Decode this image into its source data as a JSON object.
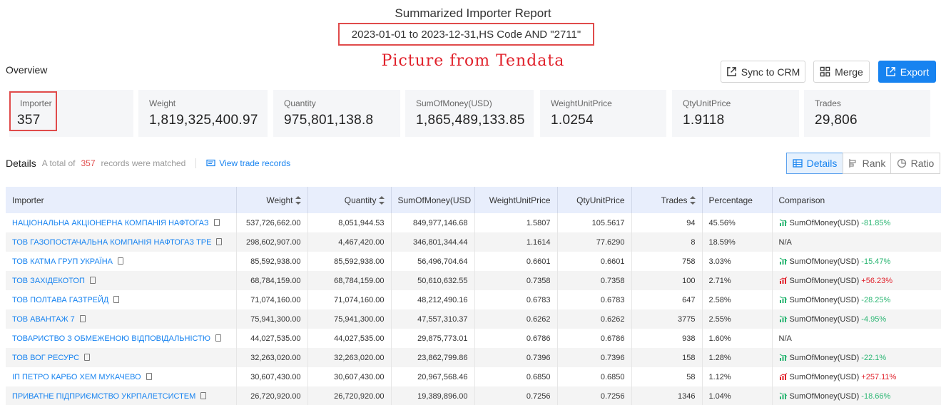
{
  "report": {
    "title": "Summarized Importer Report",
    "subtitle": "2023-01-01 to 2023-12-31,HS Code AND \"2711\"",
    "watermark": "Picture from Tendata"
  },
  "overview": {
    "label": "Overview",
    "buttons": {
      "sync": "Sync to CRM",
      "merge": "Merge",
      "export": "Export"
    },
    "stats": [
      {
        "label": "Importer",
        "value": "357"
      },
      {
        "label": "Weight",
        "value": "1,819,325,400.97"
      },
      {
        "label": "Quantity",
        "value": "975,801,138.8"
      },
      {
        "label": "SumOfMoney(USD)",
        "value": "1,865,489,133.85"
      },
      {
        "label": "WeightUnitPrice",
        "value": "1.0254"
      },
      {
        "label": "QtyUnitPrice",
        "value": "1.9118"
      },
      {
        "label": "Trades",
        "value": "29,806"
      }
    ]
  },
  "details": {
    "label": "Details",
    "total_prefix": "A total of",
    "total_count": "357",
    "total_suffix": "records were matched",
    "view_link": "View trade records",
    "tabs": [
      "Details",
      "Rank",
      "Ratio"
    ],
    "columns": [
      "Importer",
      "Weight",
      "Quantity",
      "SumOfMoney(USD",
      "WeightUnitPrice",
      "QtyUnitPrice",
      "Trades",
      "Percentage",
      "Comparison"
    ],
    "rows": [
      {
        "importer": "НАЦІОНАЛЬНА АКЦІОНЕРНА КОМПАНІЯ НАФТОГАЗ",
        "weight": "537,726,662.00",
        "quantity": "8,051,944.53",
        "money": "849,977,146.68",
        "wup": "1.5807",
        "qup": "105.5617",
        "trades": "94",
        "pct": "45.56%",
        "cmp_label": "SumOfMoney(USD)",
        "cmp_val": "-81.85%",
        "dir": "down"
      },
      {
        "importer": "ТОВ ГАЗОПОСТАЧАЛЬНА КОМПАНІЯ НАФТОГАЗ ТРЕ",
        "weight": "298,602,907.00",
        "quantity": "4,467,420.00",
        "money": "346,801,344.44",
        "wup": "1.1614",
        "qup": "77.6290",
        "trades": "8",
        "pct": "18.59%",
        "cmp_label": "N/A",
        "cmp_val": "",
        "dir": "none"
      },
      {
        "importer": "ТОВ КАТМА ГРУП УКРАЇНА",
        "weight": "85,592,938.00",
        "quantity": "85,592,938.00",
        "money": "56,496,704.64",
        "wup": "0.6601",
        "qup": "0.6601",
        "trades": "758",
        "pct": "3.03%",
        "cmp_label": "SumOfMoney(USD)",
        "cmp_val": "-15.47%",
        "dir": "down"
      },
      {
        "importer": "ТОВ ЗАХІДЕКОТОП",
        "weight": "68,784,159.00",
        "quantity": "68,784,159.00",
        "money": "50,610,632.55",
        "wup": "0.7358",
        "qup": "0.7358",
        "trades": "100",
        "pct": "2.71%",
        "cmp_label": "SumOfMoney(USD)",
        "cmp_val": "+56.23%",
        "dir": "up"
      },
      {
        "importer": "ТОВ ПОЛТАВА ГАЗТРЕЙД",
        "weight": "71,074,160.00",
        "quantity": "71,074,160.00",
        "money": "48,212,490.16",
        "wup": "0.6783",
        "qup": "0.6783",
        "trades": "647",
        "pct": "2.58%",
        "cmp_label": "SumOfMoney(USD)",
        "cmp_val": "-28.25%",
        "dir": "down"
      },
      {
        "importer": "ТОВ АВАНТАЖ 7",
        "weight": "75,941,300.00",
        "quantity": "75,941,300.00",
        "money": "47,557,310.37",
        "wup": "0.6262",
        "qup": "0.6262",
        "trades": "3775",
        "pct": "2.55%",
        "cmp_label": "SumOfMoney(USD)",
        "cmp_val": "-4.95%",
        "dir": "down"
      },
      {
        "importer": "ТОВАРИСТВО З ОБМЕЖЕНОЮ ВІДПОВІДАЛЬНІСТЮ",
        "weight": "44,027,535.00",
        "quantity": "44,027,535.00",
        "money": "29,875,773.01",
        "wup": "0.6786",
        "qup": "0.6786",
        "trades": "938",
        "pct": "1.60%",
        "cmp_label": "N/A",
        "cmp_val": "",
        "dir": "none"
      },
      {
        "importer": "ТОВ ВОГ РЕСУРС",
        "weight": "32,263,020.00",
        "quantity": "32,263,020.00",
        "money": "23,862,799.86",
        "wup": "0.7396",
        "qup": "0.7396",
        "trades": "158",
        "pct": "1.28%",
        "cmp_label": "SumOfMoney(USD)",
        "cmp_val": "-22.1%",
        "dir": "down"
      },
      {
        "importer": "ІП ПЕТРО КАРБО ХЕМ МУКАЧЕВО",
        "weight": "30,607,430.00",
        "quantity": "30,607,430.00",
        "money": "20,967,568.46",
        "wup": "0.6850",
        "qup": "0.6850",
        "trades": "58",
        "pct": "1.12%",
        "cmp_label": "SumOfMoney(USD)",
        "cmp_val": "+257.11%",
        "dir": "up"
      },
      {
        "importer": "ПРИВАТНЕ ПІДПРИЄМСТВО УКРПАЛЕТСИСТЕМ",
        "weight": "26,720,920.00",
        "quantity": "26,720,920.00",
        "money": "19,389,896.00",
        "wup": "0.7256",
        "qup": "0.7256",
        "trades": "1346",
        "pct": "1.04%",
        "cmp_label": "SumOfMoney(USD)",
        "cmp_val": "-18.66%",
        "dir": "down"
      }
    ]
  },
  "colors": {
    "accent": "#1783f0",
    "highlight_box": "#e04b4b",
    "negative": "#2bb673",
    "positive": "#e0202a"
  }
}
